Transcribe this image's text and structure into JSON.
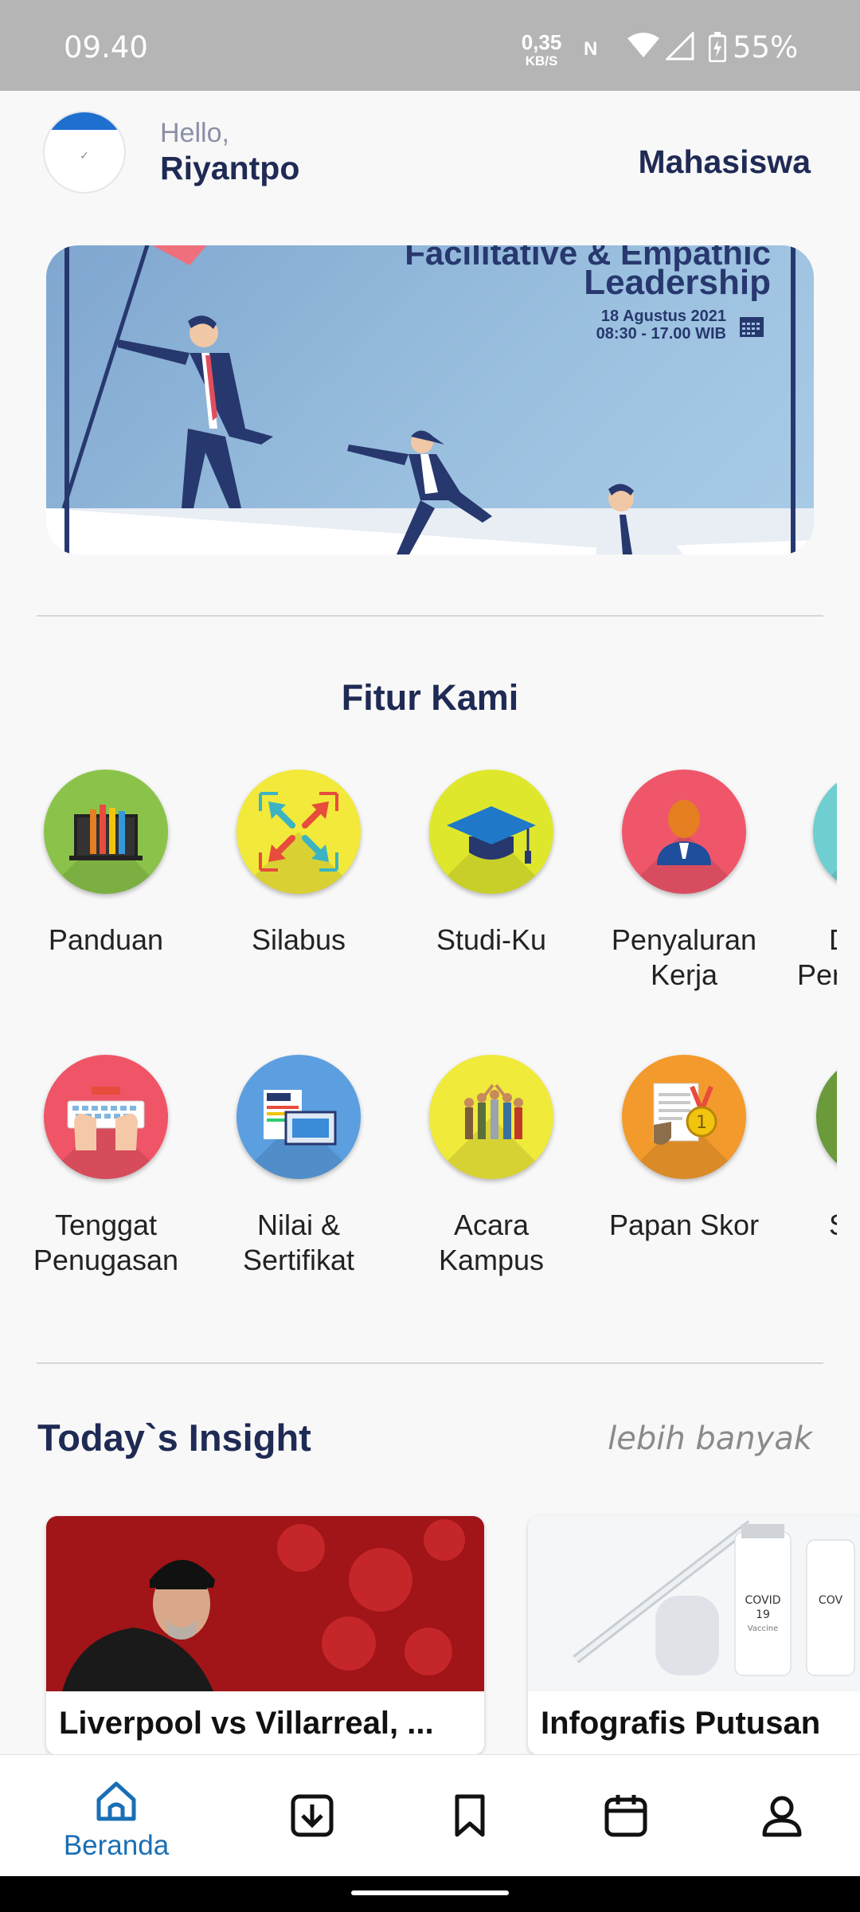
{
  "status_bar": {
    "time": "09.40",
    "net_speed_value": "0,35",
    "net_speed_unit": "KB/S",
    "nfc_label": "N",
    "battery": "55%"
  },
  "header": {
    "greeting": "Hello,",
    "username": "Riyantpo",
    "role": "Mahasiswa",
    "avatar_text": "✓"
  },
  "banner": {
    "title_line1": "Facilitative & Empathic",
    "title_line2": "Leadership",
    "date": "18 Agustus 2021",
    "time": "08:30 - 17.00 WIB"
  },
  "features": {
    "title": "Fitur Kami",
    "row1": [
      {
        "line1": "Panduan",
        "line2": "",
        "color": "#8bc34a",
        "icon": "books-icon"
      },
      {
        "line1": "Silabus",
        "line2": "",
        "color": "#f2e93a",
        "icon": "expand-arrows-icon"
      },
      {
        "line1": "Studi-Ku",
        "line2": "",
        "color": "#dfe72d",
        "icon": "graduation-cap-icon"
      },
      {
        "line1": "Penyaluran",
        "line2": "Kerja",
        "color": "#f0566a",
        "icon": "worker-icon"
      },
      {
        "line1": "D",
        "line2": "Per",
        "color": "#6fcfd0",
        "icon": "partial-icon"
      }
    ],
    "row2": [
      {
        "line1": "Tenggat",
        "line2": "Penugasan",
        "color": "#ef5566",
        "icon": "keyboard-hands-icon"
      },
      {
        "line1": "Nilai &",
        "line2": "Sertifikat",
        "color": "#5b9fe0",
        "icon": "certificate-icon"
      },
      {
        "line1": "Acara",
        "line2": "Kampus",
        "color": "#f0ea3a",
        "icon": "people-group-icon"
      },
      {
        "line1": "Papan Skor",
        "line2": "",
        "color": "#f39a2c",
        "icon": "medal-icon"
      },
      {
        "line1": "S",
        "line2": "",
        "color": "#6a9a3a",
        "icon": "partial-icon"
      }
    ]
  },
  "insight": {
    "title": "Today`s Insight",
    "more_label": "lebih banyak",
    "cards": [
      {
        "title": "Liverpool vs Villarreal, ..."
      },
      {
        "title": "Infografis Putusan"
      }
    ]
  },
  "bottom_nav": {
    "home_label": "Beranda",
    "active_color": "#1a6fb5"
  }
}
